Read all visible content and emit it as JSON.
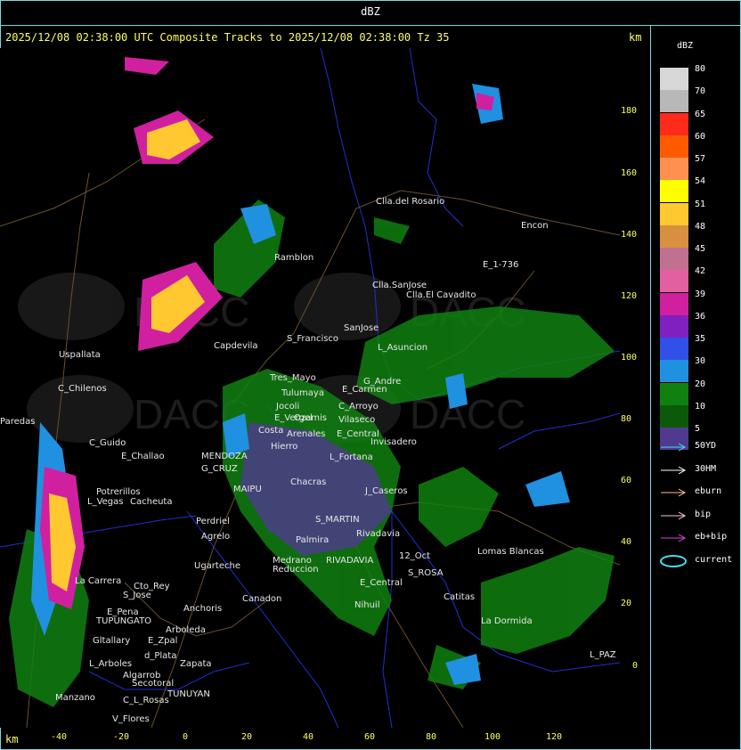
{
  "title": "dBZ",
  "header": "2025/12/08 02:38:00 UTC Composite Tracks to 2025/12/08 02:38:00 Tz 35",
  "km_label": "km",
  "y_ticks": [
    "180",
    "160",
    "140",
    "120",
    "100",
    "80",
    "60",
    "40",
    "20",
    "0"
  ],
  "x_ticks": [
    "-40",
    "-20",
    "0",
    "20",
    "40",
    "60",
    "80",
    "100",
    "120"
  ],
  "legend": {
    "title": "dBZ",
    "bins": [
      {
        "label": "80",
        "color": "#d8d8d8"
      },
      {
        "label": "70",
        "color": "#b8b8b8"
      },
      {
        "label": "65",
        "color": "#ff2a1a"
      },
      {
        "label": "60",
        "color": "#ff5a00"
      },
      {
        "label": "57",
        "color": "#ff9050"
      },
      {
        "label": "54",
        "color": "#ffff00"
      },
      {
        "label": "51",
        "color": "#ffc830"
      },
      {
        "label": "48",
        "color": "#d89040"
      },
      {
        "label": "45",
        "color": "#c07090"
      },
      {
        "label": "42",
        "color": "#e060a0"
      },
      {
        "label": "39",
        "color": "#d020a0"
      },
      {
        "label": "36",
        "color": "#8020c0"
      },
      {
        "label": "35",
        "color": "#3050e8"
      },
      {
        "label": "30",
        "color": "#2090e0"
      },
      {
        "label": "20",
        "color": "#108010"
      },
      {
        "label": "10",
        "color": "#0a5a0a"
      },
      {
        "label": "5",
        "color": "#503a90"
      }
    ]
  },
  "tracks": [
    {
      "label": "50YD",
      "color": "#40e0e0"
    },
    {
      "label": "30HM",
      "color": "#ffffff"
    },
    {
      "label": "eburn",
      "color": "#ffc080"
    },
    {
      "label": "bip",
      "color": "#ffc0e0"
    },
    {
      "label": "eb+bip",
      "color": "#e040e0"
    },
    {
      "label": "current",
      "color": "#40e0f0"
    }
  ],
  "places": [
    {
      "name": "Clla.del Rosario"
    },
    {
      "name": "Encon"
    },
    {
      "name": "E_1-736"
    },
    {
      "name": "Ramblon"
    },
    {
      "name": "Clla.SanJose"
    },
    {
      "name": "Clla.El Cavadito"
    },
    {
      "name": "Uspallata"
    },
    {
      "name": "Capdevila"
    },
    {
      "name": "S_Francisco"
    },
    {
      "name": "SanJose"
    },
    {
      "name": "L_Asuncion"
    },
    {
      "name": "C_Chilenos"
    },
    {
      "name": "Tres_Mayo"
    },
    {
      "name": "E_Carmen"
    },
    {
      "name": "G_Andre"
    },
    {
      "name": "Tulumaya"
    },
    {
      "name": "C_Arroyo"
    },
    {
      "name": "E_Vergel"
    },
    {
      "name": "Jocoli"
    },
    {
      "name": "Ozamis"
    },
    {
      "name": "Costa"
    },
    {
      "name": "Arenales"
    },
    {
      "name": "E_Central"
    },
    {
      "name": "C_Guido"
    },
    {
      "name": "Vilaseco"
    },
    {
      "name": "Hierro"
    },
    {
      "name": "Invisadero"
    },
    {
      "name": "E_Challao"
    },
    {
      "name": "MENDOZA"
    },
    {
      "name": "L_Fortana"
    },
    {
      "name": "G_CRUZ"
    },
    {
      "name": "Potrerillos"
    },
    {
      "name": "Cacheuta"
    },
    {
      "name": "L_Vegas"
    },
    {
      "name": "Chacras"
    },
    {
      "name": "J_Caseros"
    },
    {
      "name": "MAIPU"
    },
    {
      "name": "Perdriel"
    },
    {
      "name": "Agrelo"
    },
    {
      "name": "S_MARTIN"
    },
    {
      "name": "Palmira"
    },
    {
      "name": "Rivadavia"
    },
    {
      "name": "Lomas Blancas"
    },
    {
      "name": "12_Oct"
    },
    {
      "name": "S_ROSA"
    },
    {
      "name": "Ugarteche"
    },
    {
      "name": "Medrano"
    },
    {
      "name": "Reduccion"
    },
    {
      "name": "RIVADAVIA"
    },
    {
      "name": "La Carrera"
    },
    {
      "name": "Cto_Rey"
    },
    {
      "name": "S_Jose"
    },
    {
      "name": "Catitas"
    },
    {
      "name": "E_Central"
    },
    {
      "name": "Nihuil"
    },
    {
      "name": "E_Pena"
    },
    {
      "name": "TUPUNGATO"
    },
    {
      "name": "Anchoris"
    },
    {
      "name": "Arboleda"
    },
    {
      "name": "La Dormida"
    },
    {
      "name": "Gltallary"
    },
    {
      "name": "E_Zpal"
    },
    {
      "name": "d_Plata"
    },
    {
      "name": "L_Arboles"
    },
    {
      "name": "Algarrob"
    },
    {
      "name": "Zapata"
    },
    {
      "name": "L_PAZ"
    },
    {
      "name": "Secotoral"
    },
    {
      "name": "TUNUYAN"
    },
    {
      "name": "Manzano"
    },
    {
      "name": "C_L_Rosas"
    },
    {
      "name": "V_Flores"
    },
    {
      "name": "Paredas"
    },
    {
      "name": "Canadon"
    }
  ],
  "watermarks": [
    {
      "text": "DACC"
    },
    {
      "text": "DACC"
    },
    {
      "text": "DACC"
    },
    {
      "text": "DACC"
    }
  ]
}
